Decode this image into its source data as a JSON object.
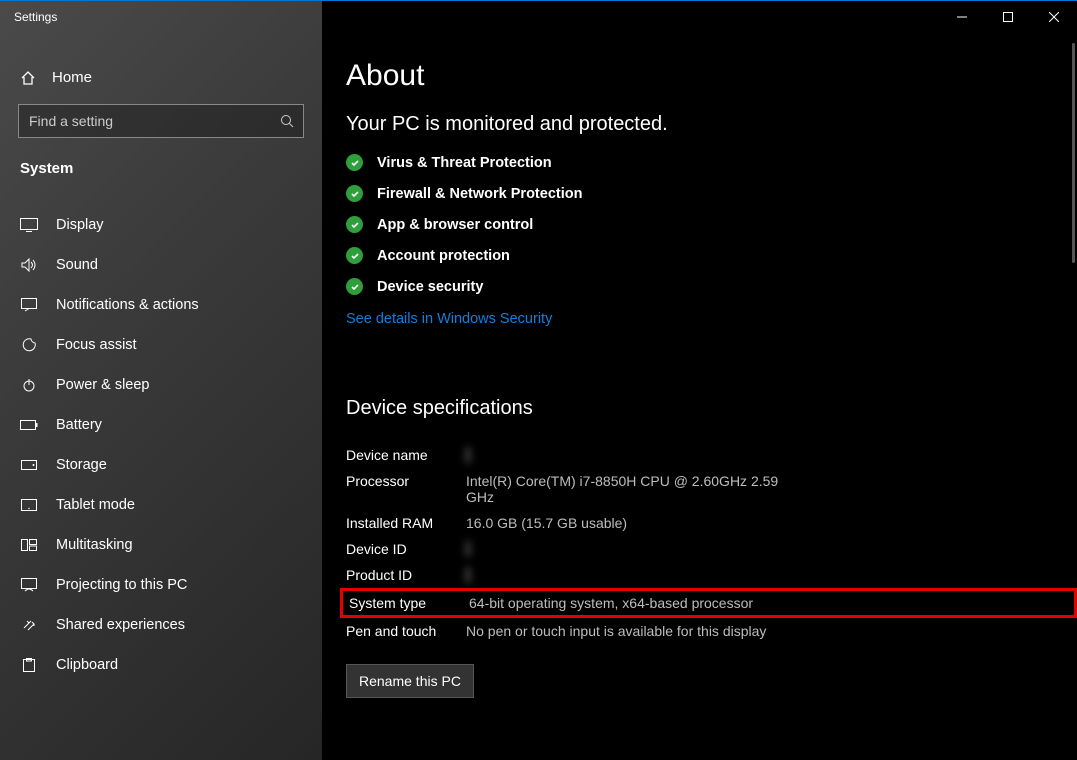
{
  "window": {
    "title": "Settings"
  },
  "sidebar": {
    "home": "Home",
    "search_placeholder": "Find a setting",
    "category": "System",
    "items": [
      {
        "label": "Display"
      },
      {
        "label": "Sound"
      },
      {
        "label": "Notifications & actions"
      },
      {
        "label": "Focus assist"
      },
      {
        "label": "Power & sleep"
      },
      {
        "label": "Battery"
      },
      {
        "label": "Storage"
      },
      {
        "label": "Tablet mode"
      },
      {
        "label": "Multitasking"
      },
      {
        "label": "Projecting to this PC"
      },
      {
        "label": "Shared experiences"
      },
      {
        "label": "Clipboard"
      }
    ]
  },
  "main": {
    "title": "About",
    "protection_heading": "Your PC is monitored and protected.",
    "protections": [
      "Virus & Threat Protection",
      "Firewall & Network Protection",
      "App & browser control",
      "Account protection",
      "Device security"
    ],
    "security_link": "See details in Windows Security",
    "device_spec_heading": "Device specifications",
    "specs": {
      "device_name_label": "Device name",
      "processor_label": "Processor",
      "processor_value": "Intel(R) Core(TM) i7-8850H CPU @ 2.60GHz   2.59 GHz",
      "ram_label": "Installed RAM",
      "ram_value": "16.0 GB (15.7 GB usable)",
      "device_id_label": "Device ID",
      "product_id_label": "Product ID",
      "system_type_label": "System type",
      "system_type_value": "64-bit operating system, x64-based processor",
      "pen_label": "Pen and touch",
      "pen_value": "No pen or touch input is available for this display"
    },
    "rename_btn": "Rename this PC"
  }
}
